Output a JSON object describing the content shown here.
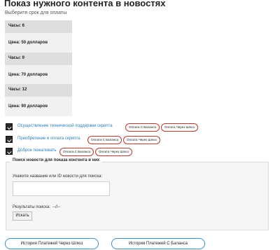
{
  "page": {
    "title": "Показ нужного контента в новостях",
    "subtitle": "Выберите срок для оплаты"
  },
  "plans": [
    {
      "hours_label": "Часы: 6",
      "price_label": "Цена: 50 долларов"
    },
    {
      "hours_label": "Часы: 9",
      "price_label": "Цена: 70 долларов"
    },
    {
      "hours_label": "Часы: 12",
      "price_label": "Цена: 90 долларов"
    }
  ],
  "actions": [
    {
      "label": "Осуществление технической поддержки скрипта",
      "pay_balance": "Оплата С Баланса",
      "pay_gateway": "Оплата Через Шлюз"
    },
    {
      "label": "Приобретение и оплата скрипта",
      "pay_balance": "Оплата С Баланса",
      "pay_gateway": "Оплата Через Шлюз"
    },
    {
      "label": "Доброе пожаловать",
      "pay_balance": "Оплата С Баланса",
      "pay_gateway": "Оплата Через Шлюз"
    }
  ],
  "search": {
    "legend": "Поиск новости для показа контента в них",
    "label": "Укажите название или ID новости для поиска:",
    "value": "",
    "results_label": "Результаты поиска:",
    "results_value": "--//--",
    "button_label": "Искать"
  },
  "footer": {
    "history_gateway": "История Платежей Через Шлюз",
    "history_balance": "История Платежей С Баланса"
  },
  "colors": {
    "link": "#2a7fb8",
    "pill_border": "#c0392b",
    "button_border": "#3a8fd0"
  }
}
